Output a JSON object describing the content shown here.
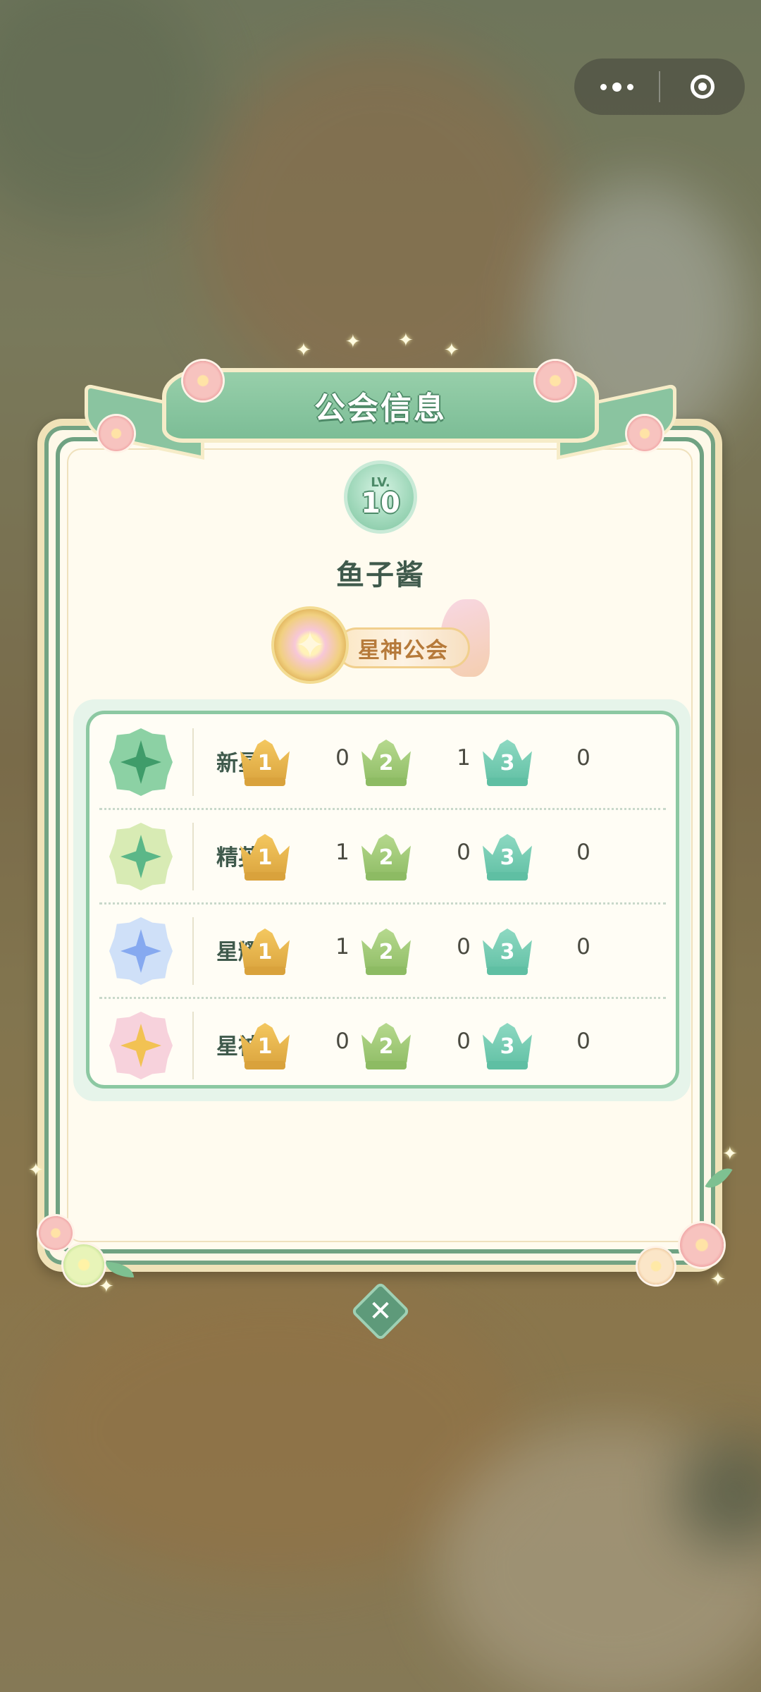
{
  "capsule": {
    "more_icon": "more-dots-icon",
    "target_icon": "target-icon"
  },
  "dialog": {
    "title": "公会信息",
    "level_prefix": "LV.",
    "level": "10",
    "guild_name": "鱼子酱",
    "rank_title": "星神公会"
  },
  "crowns": [
    {
      "label": "1",
      "color": "#f4c860",
      "dark": "#d9a23c"
    },
    {
      "label": "2",
      "color": "#b6d98e",
      "dark": "#8dbb63"
    },
    {
      "label": "3",
      "color": "#8ed9c2",
      "dark": "#5fbfa3"
    }
  ],
  "tiers": [
    {
      "name": "新星",
      "medal_color": "#8cd1a4",
      "medal_inner": "#3f9c6a",
      "counts": [
        "0",
        "1",
        "0"
      ]
    },
    {
      "name": "精英",
      "medal_color": "#d8ebb4",
      "medal_inner": "#5bb788",
      "counts": [
        "1",
        "0",
        "0"
      ]
    },
    {
      "name": "星耀",
      "medal_color": "#cfe0f8",
      "medal_inner": "#86a9f0",
      "counts": [
        "1",
        "0",
        "0"
      ]
    },
    {
      "name": "星神",
      "medal_color": "#f7d2dc",
      "medal_inner": "#f2c253",
      "counts": [
        "0",
        "0",
        "0"
      ]
    }
  ],
  "close_icon": "close-icon"
}
